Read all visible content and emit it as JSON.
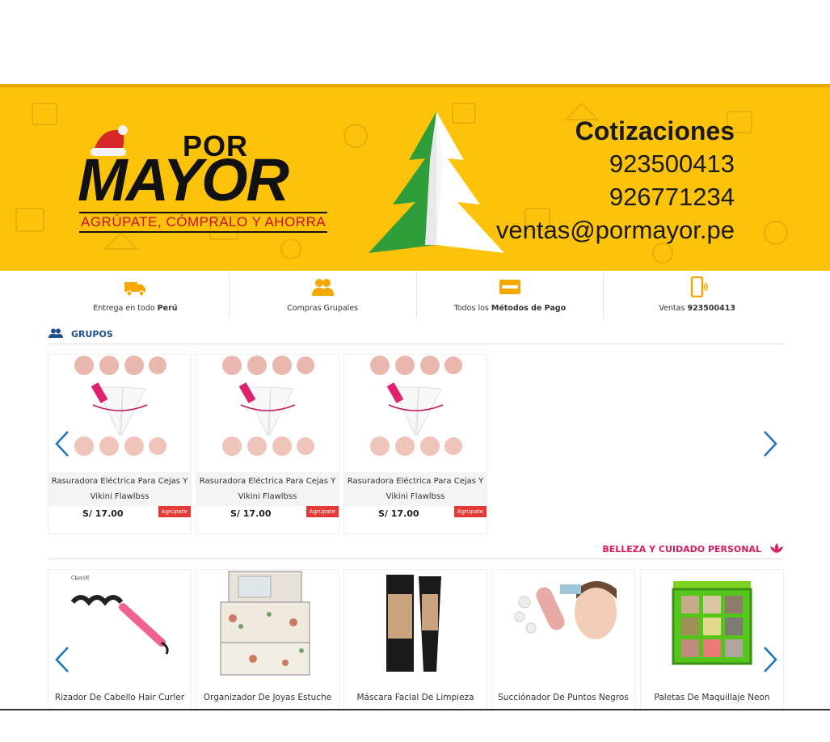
{
  "banner": {
    "logo": {
      "por": "POR",
      "mayor": "MAYOR",
      "tagline": "AGRÚPATE, CÓMPRALO Y AHORRA"
    },
    "contact": {
      "title": "Cotizaciones",
      "phone1": "923500413",
      "phone2": "926771234",
      "email": "ventas@pormayor.pe"
    },
    "colors": {
      "background": "#fdc20a",
      "tree_green": "#2e9d3a",
      "tag_red": "#c8102e"
    }
  },
  "features": [
    {
      "icon": "truck-icon",
      "text_pre": "Entrega en todo ",
      "text_bold": "Perú",
      "text_post": ""
    },
    {
      "icon": "users-icon",
      "text_pre": "Compras Grupales",
      "text_bold": "",
      "text_post": ""
    },
    {
      "icon": "credit-card-icon",
      "text_pre": "Todos los ",
      "text_bold": "Métodos de Pago",
      "text_post": ""
    },
    {
      "icon": "phone-icon",
      "text_pre": "Ventas ",
      "text_bold": "923500413",
      "text_post": ""
    }
  ],
  "groups_section": {
    "title": "GRUPOS",
    "products": [
      {
        "name": "Rasuradora Eléctrica Para Cejas Y Vikini Flawlbss",
        "price": "S/ 17.00",
        "badge": "Agrúpate"
      },
      {
        "name": "Rasuradora Eléctrica Para Cejas Y Vikini Flawlbss",
        "price": "S/ 17.00",
        "badge": "Agrúpate"
      },
      {
        "name": "Rasuradora Eléctrica Para Cejas Y Vikini Flawlbss",
        "price": "S/ 17.00",
        "badge": "Agrúpate"
      }
    ]
  },
  "beauty_section": {
    "title": "BELLEZA Y CUIDADO PERSONAL",
    "products": [
      {
        "name": "Rizador De Cabello Hair Curler Espiral Ondas"
      },
      {
        "name": "Organizador De Joyas Estuche De Cuero Varios Niveles"
      },
      {
        "name": "Máscara Facial De Limpieza Profunda"
      },
      {
        "name": "Succiónador De Puntos Negros Espinilla Removedor Facial"
      },
      {
        "name": "Paletas De Maquillaje Neon Verde"
      }
    ],
    "image_text": {
      "curler_brand": "CkeyiN"
    }
  },
  "accent_colors": {
    "groups_title": "#1f4e8c",
    "beauty_title": "#d81b60",
    "feature_icons": "#f5a800",
    "arrow": "#1e73be",
    "badge": "#e53935"
  }
}
